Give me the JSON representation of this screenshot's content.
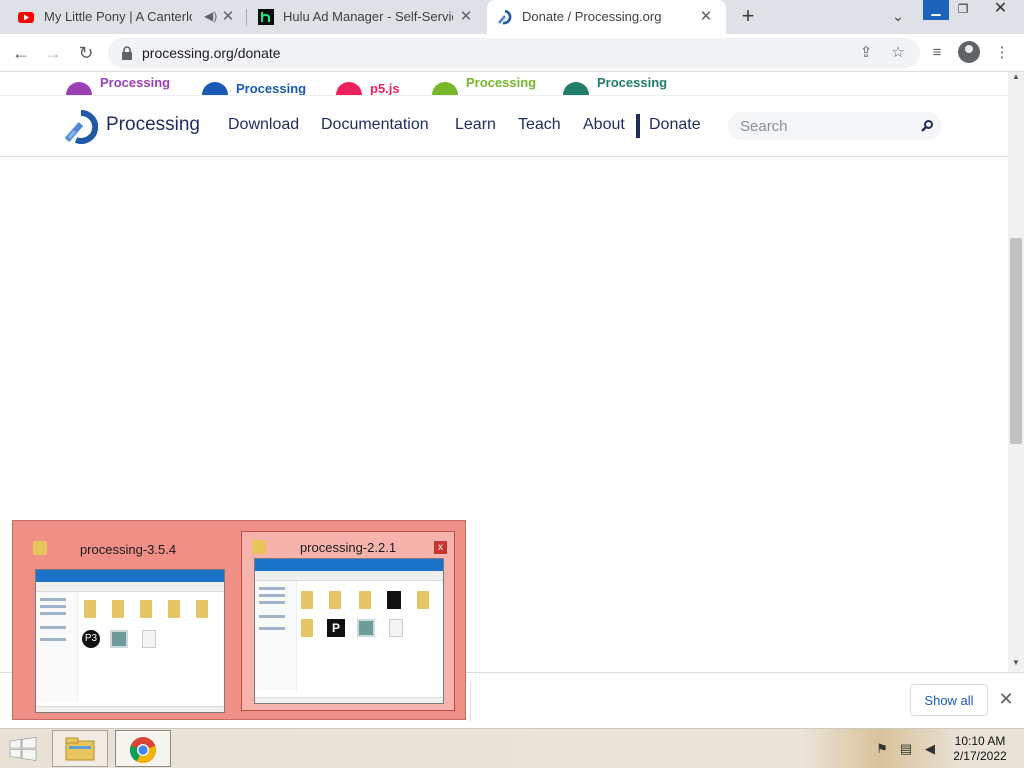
{
  "browser": {
    "tabs": [
      {
        "title": "My Little Pony | A Canterlot Wedding",
        "favicon": "youtube-icon",
        "audio": true,
        "active": false
      },
      {
        "title": "Hulu Ad Manager - Self-Service",
        "favicon": "hulu-icon",
        "active": false
      },
      {
        "title": "Donate / Processing.org",
        "favicon": "processing-icon",
        "active": true
      }
    ],
    "close_glyph": "✕",
    "new_tab_glyph": "+",
    "tab_search_glyph": "⌄",
    "window_controls": {
      "minimize": "▁",
      "restore": "❐",
      "close": "✕"
    },
    "address": {
      "url": "processing.org/donate"
    },
    "nav": {
      "back": "←",
      "forward": "→",
      "reload": "↻"
    },
    "toolbar_glyphs": {
      "share": "⇪",
      "bookmark": "☆",
      "media": "≡",
      "menu": "⋮"
    }
  },
  "site": {
    "foundation_bar": [
      {
        "label": "Processing",
        "color": "#9b3fb5"
      },
      {
        "label": "Processing",
        "color": "#1a5ab5"
      },
      {
        "label": "p5.js",
        "color": "#ed225d"
      },
      {
        "label": "Processing",
        "color": "#76b82a"
      },
      {
        "label": "Processing",
        "color": "#1f7f6b"
      }
    ],
    "brand": "Processing",
    "nav": [
      "Download",
      "Documentation",
      "Learn",
      "Teach",
      "About",
      "Donate"
    ],
    "search_placeholder": "Search",
    "accent": "#1f2d5c"
  },
  "downloads": {
    "show_all": "Show all",
    "close_glyph": "✕"
  },
  "taskbar_preview": {
    "windows": [
      {
        "title": "processing-3.5.4",
        "preview_logo": "P3"
      },
      {
        "title": "processing-2.2.1",
        "preview_logo": "P",
        "close_glyph": "x"
      }
    ]
  },
  "taskbar": {
    "apps": [
      {
        "name": "file-explorer"
      },
      {
        "name": "google-chrome"
      }
    ],
    "clock": {
      "time": "10:10 AM",
      "date": "2/17/2022"
    }
  }
}
